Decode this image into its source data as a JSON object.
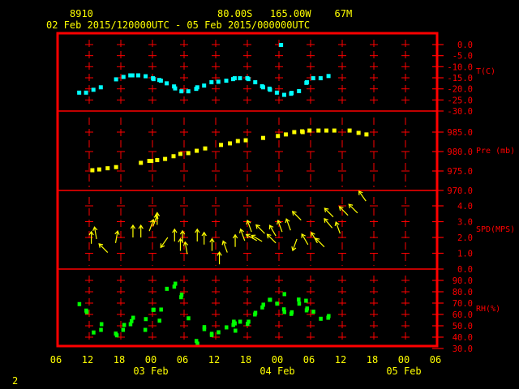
{
  "header": {
    "station": "8910",
    "location": "80.00S   165.00W    67M",
    "period": "02 Feb 2015/120000UTC - 05 Feb 2015/000000UTC"
  },
  "footer": {
    "page": "2"
  },
  "colors": {
    "frame": "#ff0000",
    "labels": "#ff0000",
    "text": "#ffff00",
    "temperature": "#00ffff",
    "pressure": "#ffff00",
    "wind": "#ffff00",
    "rh": "#00ff00"
  },
  "chart_data": {
    "type": "scatter",
    "xlim": [
      "2015-02-02T06:00Z",
      "2015-02-05T06:00Z"
    ],
    "x_ticks": [
      "06",
      "12",
      "18",
      "00",
      "06",
      "12",
      "18",
      "00",
      "06",
      "12",
      "18",
      "00",
      "06"
    ],
    "x_date_labels": [
      {
        "at": "2015-02-03T00:00Z",
        "label": "03 Feb"
      },
      {
        "at": "2015-02-04T00:00Z",
        "label": "04 Feb"
      },
      {
        "at": "2015-02-05T00:00Z",
        "label": "05 Feb"
      }
    ],
    "grid": true,
    "panels": [
      {
        "key": "temp",
        "ylabel": "T(C)",
        "ylim": [
          -30,
          0
        ],
        "ticks": [
          {
            "v": 0,
            "label": "0.0"
          },
          {
            "v": -5,
            "label": "-5.0"
          },
          {
            "v": -10,
            "label": "-10.0"
          },
          {
            "v": -15,
            "label": "-15.0"
          },
          {
            "v": -20,
            "label": "-20.0"
          },
          {
            "v": -25,
            "label": "-25.0"
          },
          {
            "v": -30,
            "label": "-30.0"
          }
        ],
        "points": [
          [
            "2015-02-02T10:06Z",
            -21.7
          ],
          [
            "2015-02-02T11:24Z",
            -21.7
          ],
          [
            "2015-02-02T12:48Z",
            -20.4
          ],
          [
            "2015-02-02T14:12Z",
            -19.3
          ],
          [
            "2015-02-02T17:06Z",
            -15.7
          ],
          [
            "2015-02-02T18:30Z",
            -14.6
          ],
          [
            "2015-02-02T19:48Z",
            -13.9
          ],
          [
            "2015-02-02T20:12Z",
            -13.9
          ],
          [
            "2015-02-02T21:18Z",
            -13.9
          ],
          [
            "2015-02-02T22:42Z",
            -14.3
          ],
          [
            "2015-02-03T00:06Z",
            -15.2
          ],
          [
            "2015-02-03T00:12Z",
            -15.6
          ],
          [
            "2015-02-03T01:18Z",
            -16.0
          ],
          [
            "2015-02-03T01:36Z",
            -16.3
          ],
          [
            "2015-02-03T02:42Z",
            -17.5
          ],
          [
            "2015-02-03T04:06Z",
            -18.9
          ],
          [
            "2015-02-03T04:18Z",
            -19.8
          ],
          [
            "2015-02-03T05:30Z",
            -21.1
          ],
          [
            "2015-02-03T06:48Z",
            -21.1
          ],
          [
            "2015-02-03T08:18Z",
            -20.0
          ],
          [
            "2015-02-03T08:30Z",
            -19.3
          ],
          [
            "2015-02-03T09:48Z",
            -18.5
          ],
          [
            "2015-02-03T11:12Z",
            -17.0
          ],
          [
            "2015-02-03T12:30Z",
            -16.8
          ],
          [
            "2015-02-03T14:00Z",
            -16.3
          ],
          [
            "2015-02-03T15:18Z",
            -15.6
          ],
          [
            "2015-02-03T15:36Z",
            -15.2
          ],
          [
            "2015-02-03T16:36Z",
            -15.2
          ],
          [
            "2015-02-03T18:00Z",
            -15.2
          ],
          [
            "2015-02-03T18:12Z",
            -15.6
          ],
          [
            "2015-02-03T19:30Z",
            -17.0
          ],
          [
            "2015-02-03T20:48Z",
            -18.8
          ],
          [
            "2015-02-03T21:00Z",
            -19.3
          ],
          [
            "2015-02-03T22:12Z",
            -19.9
          ],
          [
            "2015-02-03T22:18Z",
            -20.4
          ],
          [
            "2015-02-03T23:36Z",
            -21.7
          ],
          [
            "2015-02-04T00:24Z",
            -0.2
          ],
          [
            "2015-02-04T01:00Z",
            -22.7
          ],
          [
            "2015-02-04T02:18Z",
            -22.2
          ],
          [
            "2015-02-04T02:24Z",
            -21.8
          ],
          [
            "2015-02-04T03:48Z",
            -21.0
          ],
          [
            "2015-02-04T05:12Z",
            -17.3
          ],
          [
            "2015-02-04T05:18Z",
            -17.0
          ],
          [
            "2015-02-04T06:30Z",
            -15.2
          ],
          [
            "2015-02-04T07:54Z",
            -15.2
          ],
          [
            "2015-02-04T09:24Z",
            -14.2
          ]
        ]
      },
      {
        "key": "pres",
        "ylabel": "Pre (mb)",
        "ylim": [
          970,
          985
        ],
        "ticks": [
          {
            "v": 985,
            "label": "985.0"
          },
          {
            "v": 980,
            "label": "980.0"
          },
          {
            "v": 975,
            "label": "975.0"
          },
          {
            "v": 970,
            "label": "970.0"
          }
        ],
        "points": [
          [
            "2015-02-02T12:36Z",
            975.2
          ],
          [
            "2015-02-02T13:54Z",
            975.4
          ],
          [
            "2015-02-02T15:30Z",
            975.7
          ],
          [
            "2015-02-02T17:06Z",
            976.0
          ],
          [
            "2015-02-02T21:48Z",
            977.1
          ],
          [
            "2015-02-02T23:24Z",
            977.6
          ],
          [
            "2015-02-02T23:48Z",
            977.6
          ],
          [
            "2015-02-03T00:54Z",
            977.8
          ],
          [
            "2015-02-03T02:24Z",
            978.1
          ],
          [
            "2015-02-03T04:00Z",
            978.8
          ],
          [
            "2015-02-03T05:18Z",
            979.4
          ],
          [
            "2015-02-03T06:48Z",
            979.6
          ],
          [
            "2015-02-03T08:24Z",
            980.2
          ],
          [
            "2015-02-03T10:00Z",
            980.8
          ],
          [
            "2015-02-03T13:00Z",
            981.7
          ],
          [
            "2015-02-03T14:42Z",
            982.1
          ],
          [
            "2015-02-03T16:12Z",
            982.7
          ],
          [
            "2015-02-03T17:42Z",
            982.9
          ],
          [
            "2015-02-03T21:00Z",
            983.5
          ],
          [
            "2015-02-03T23:48Z",
            984.0
          ],
          [
            "2015-02-04T01:18Z",
            984.4
          ],
          [
            "2015-02-04T02:54Z",
            985.0
          ],
          [
            "2015-02-04T04:24Z",
            985.2
          ],
          [
            "2015-02-04T04:30Z",
            985.0
          ],
          [
            "2015-02-04T05:48Z",
            985.4
          ],
          [
            "2015-02-04T07:30Z",
            985.4
          ],
          [
            "2015-02-04T09:00Z",
            985.4
          ],
          [
            "2015-02-04T10:30Z",
            985.4
          ],
          [
            "2015-02-04T13:24Z",
            985.4
          ],
          [
            "2015-02-04T15:06Z",
            984.8
          ],
          [
            "2015-02-04T16:36Z",
            984.4
          ]
        ]
      },
      {
        "key": "wind",
        "ylabel": "SPD(MPS)",
        "ylim": [
          0,
          4
        ],
        "ticks": [
          {
            "v": 4,
            "label": "4.0"
          },
          {
            "v": 3,
            "label": "3.0"
          },
          {
            "v": 2,
            "label": "2.0"
          },
          {
            "v": 1,
            "label": "1.0"
          },
          {
            "v": 0,
            "label": "0.0"
          }
        ],
        "points_fields": [
          "time",
          "speed_mps",
          "arrow_direction_deg"
        ],
        "points": [
          [
            "2015-02-02T12:24Z",
            1.6,
            0
          ],
          [
            "2015-02-02T13:24Z",
            1.9,
            350
          ],
          [
            "2015-02-02T15:30Z",
            1.05,
            315
          ],
          [
            "2015-02-02T17:00Z",
            1.65,
            10
          ],
          [
            "2015-02-02T20:18Z",
            2.0,
            0
          ],
          [
            "2015-02-02T21:48Z",
            2.0,
            0
          ],
          [
            "2015-02-02T23:24Z",
            2.4,
            20
          ],
          [
            "2015-02-03T00:06Z",
            2.7,
            20
          ],
          [
            "2015-02-03T00:54Z",
            2.8,
            0
          ],
          [
            "2015-02-03T02:54Z",
            2.0,
            215
          ],
          [
            "2015-02-03T04:12Z",
            1.75,
            0
          ],
          [
            "2015-02-03T05:42Z",
            1.65,
            0
          ],
          [
            "2015-02-03T05:18Z",
            1.15,
            0
          ],
          [
            "2015-02-03T06:36Z",
            0.95,
            350
          ],
          [
            "2015-02-03T08:30Z",
            1.75,
            0
          ],
          [
            "2015-02-03T09:48Z",
            1.55,
            0
          ],
          [
            "2015-02-03T11:18Z",
            1.15,
            0
          ],
          [
            "2015-02-03T12:42Z",
            0.3,
            0
          ],
          [
            "2015-02-03T14:12Z",
            1.05,
            340
          ],
          [
            "2015-02-03T15:42Z",
            1.4,
            0
          ],
          [
            "2015-02-03T17:30Z",
            1.8,
            340
          ],
          [
            "2015-02-03T18:48Z",
            2.35,
            340
          ],
          [
            "2015-02-03T19:48Z",
            1.8,
            300
          ],
          [
            "2015-02-03T20:48Z",
            1.75,
            300
          ],
          [
            "2015-02-03T21:18Z",
            2.25,
            315
          ],
          [
            "2015-02-03T23:24Z",
            1.65,
            315
          ],
          [
            "2015-02-03T23:24Z",
            2.1,
            330
          ],
          [
            "2015-02-04T00:36Z",
            2.35,
            340
          ],
          [
            "2015-02-04T02:12Z",
            2.45,
            340
          ],
          [
            "2015-02-04T03:24Z",
            1.9,
            200
          ],
          [
            "2015-02-04T04:12Z",
            3.1,
            315
          ],
          [
            "2015-02-04T05:30Z",
            1.55,
            330
          ],
          [
            "2015-02-04T07:18Z",
            1.65,
            330
          ],
          [
            "2015-02-04T08:36Z",
            1.4,
            315
          ],
          [
            "2015-02-04T10:06Z",
            2.6,
            320
          ],
          [
            "2015-02-04T10:18Z",
            3.3,
            315
          ],
          [
            "2015-02-04T11:36Z",
            2.25,
            340
          ],
          [
            "2015-02-04T13:06Z",
            3.4,
            315
          ],
          [
            "2015-02-04T14:54Z",
            3.55,
            315
          ],
          [
            "2015-02-04T16:30Z",
            4.3,
            325
          ]
        ]
      },
      {
        "key": "rh",
        "ylabel": "RH(%)",
        "ylim": [
          30,
          90
        ],
        "ticks": [
          {
            "v": 90,
            "label": "90.0"
          },
          {
            "v": 80,
            "label": "80.0"
          },
          {
            "v": 70,
            "label": "70.0"
          },
          {
            "v": 60,
            "label": "60.0"
          },
          {
            "v": 50,
            "label": "50.0"
          },
          {
            "v": 40,
            "label": "40.0"
          },
          {
            "v": 30,
            "label": "30.0"
          }
        ],
        "points": [
          [
            "2015-02-02T10:06Z",
            69.1
          ],
          [
            "2015-02-02T11:24Z",
            63.4
          ],
          [
            "2015-02-02T11:30Z",
            62.1
          ],
          [
            "2015-02-02T12:48Z",
            44.1
          ],
          [
            "2015-02-02T14:12Z",
            46.4
          ],
          [
            "2015-02-02T14:18Z",
            51.4
          ],
          [
            "2015-02-02T17:00Z",
            43.1
          ],
          [
            "2015-02-02T17:12Z",
            41.6
          ],
          [
            "2015-02-02T18:24Z",
            46.4
          ],
          [
            "2015-02-02T18:36Z",
            50.7
          ],
          [
            "2015-02-02T19:48Z",
            51.4
          ],
          [
            "2015-02-02T20:00Z",
            54.1
          ],
          [
            "2015-02-02T20:18Z",
            57.1
          ],
          [
            "2015-02-02T22:42Z",
            55.9
          ],
          [
            "2015-02-02T22:36Z",
            46.4
          ],
          [
            "2015-02-03T00:06Z",
            64.1
          ],
          [
            "2015-02-03T00:12Z",
            64.1
          ],
          [
            "2015-02-03T01:18Z",
            54.5
          ],
          [
            "2015-02-03T01:36Z",
            64.3
          ],
          [
            "2015-02-03T02:42Z",
            82.6
          ],
          [
            "2015-02-03T04:06Z",
            84.5
          ],
          [
            "2015-02-03T04:18Z",
            87.1
          ],
          [
            "2015-02-03T05:24Z",
            75.2
          ],
          [
            "2015-02-03T05:30Z",
            77.4
          ],
          [
            "2015-02-03T06:48Z",
            56.6
          ],
          [
            "2015-02-03T08:18Z",
            36.6
          ],
          [
            "2015-02-03T08:30Z",
            34.3
          ],
          [
            "2015-02-03T09:48Z",
            48.8
          ],
          [
            "2015-02-03T09:48Z",
            47.1
          ],
          [
            "2015-02-03T11:12Z",
            42.9
          ],
          [
            "2015-02-03T11:12Z",
            41.9
          ],
          [
            "2015-02-03T12:30Z",
            44.3
          ],
          [
            "2015-02-03T14:00Z",
            48.6
          ],
          [
            "2015-02-03T15:18Z",
            50.7
          ],
          [
            "2015-02-03T15:24Z",
            53.6
          ],
          [
            "2015-02-03T15:36Z",
            52.1
          ],
          [
            "2015-02-03T15:42Z",
            45.7
          ],
          [
            "2015-02-03T16:36Z",
            53.6
          ],
          [
            "2015-02-03T18:00Z",
            51.6
          ],
          [
            "2015-02-03T18:12Z",
            53.6
          ],
          [
            "2015-02-03T19:24Z",
            60.0
          ],
          [
            "2015-02-03T19:30Z",
            61.4
          ],
          [
            "2015-02-03T20:48Z",
            66.2
          ],
          [
            "2015-02-03T21:00Z",
            68.6
          ],
          [
            "2015-02-03T22:12Z",
            72.9
          ],
          [
            "2015-02-03T22:18Z",
            72.9
          ],
          [
            "2015-02-03T23:36Z",
            69.5
          ],
          [
            "2015-02-04T01:00Z",
            77.9
          ],
          [
            "2015-02-04T00:54Z",
            64.5
          ],
          [
            "2015-02-04T01:00Z",
            62.1
          ],
          [
            "2015-02-04T02:18Z",
            60.5
          ],
          [
            "2015-02-04T02:24Z",
            61.9
          ],
          [
            "2015-02-04T03:42Z",
            73.1
          ],
          [
            "2015-02-04T03:48Z",
            69.5
          ],
          [
            "2015-02-04T05:06Z",
            72.1
          ],
          [
            "2015-02-04T05:12Z",
            63.6
          ],
          [
            "2015-02-04T05:18Z",
            65.2
          ],
          [
            "2015-02-04T06:30Z",
            62.4
          ],
          [
            "2015-02-04T07:54Z",
            56.2
          ],
          [
            "2015-02-04T09:18Z",
            57.1
          ],
          [
            "2015-02-04T09:24Z",
            58.6
          ]
        ]
      }
    ]
  }
}
